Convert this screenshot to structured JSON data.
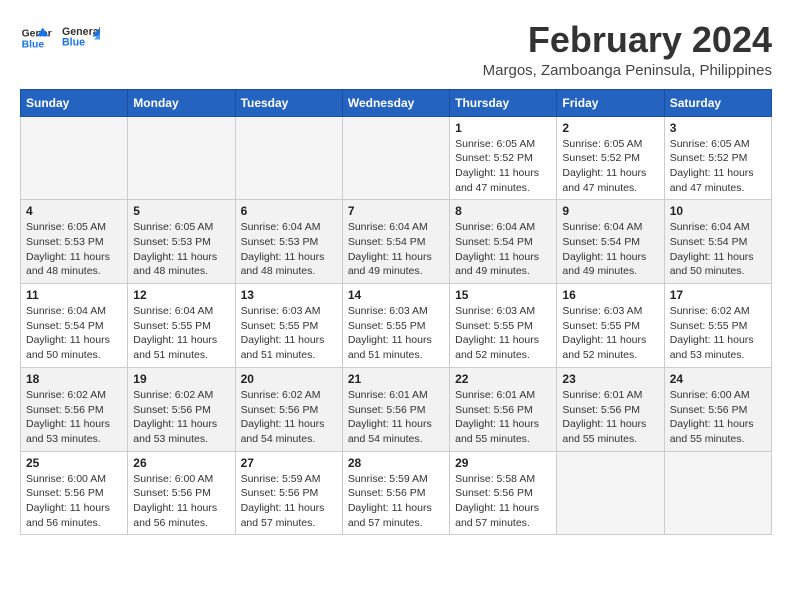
{
  "header": {
    "logo_general": "General",
    "logo_blue": "Blue",
    "month_year": "February 2024",
    "location": "Margos, Zamboanga Peninsula, Philippines"
  },
  "weekdays": [
    "Sunday",
    "Monday",
    "Tuesday",
    "Wednesday",
    "Thursday",
    "Friday",
    "Saturday"
  ],
  "weeks": [
    [
      {
        "day": "",
        "info": ""
      },
      {
        "day": "",
        "info": ""
      },
      {
        "day": "",
        "info": ""
      },
      {
        "day": "",
        "info": ""
      },
      {
        "day": "1",
        "info": "Sunrise: 6:05 AM\nSunset: 5:52 PM\nDaylight: 11 hours\nand 47 minutes."
      },
      {
        "day": "2",
        "info": "Sunrise: 6:05 AM\nSunset: 5:52 PM\nDaylight: 11 hours\nand 47 minutes."
      },
      {
        "day": "3",
        "info": "Sunrise: 6:05 AM\nSunset: 5:52 PM\nDaylight: 11 hours\nand 47 minutes."
      }
    ],
    [
      {
        "day": "4",
        "info": "Sunrise: 6:05 AM\nSunset: 5:53 PM\nDaylight: 11 hours\nand 48 minutes."
      },
      {
        "day": "5",
        "info": "Sunrise: 6:05 AM\nSunset: 5:53 PM\nDaylight: 11 hours\nand 48 minutes."
      },
      {
        "day": "6",
        "info": "Sunrise: 6:04 AM\nSunset: 5:53 PM\nDaylight: 11 hours\nand 48 minutes."
      },
      {
        "day": "7",
        "info": "Sunrise: 6:04 AM\nSunset: 5:54 PM\nDaylight: 11 hours\nand 49 minutes."
      },
      {
        "day": "8",
        "info": "Sunrise: 6:04 AM\nSunset: 5:54 PM\nDaylight: 11 hours\nand 49 minutes."
      },
      {
        "day": "9",
        "info": "Sunrise: 6:04 AM\nSunset: 5:54 PM\nDaylight: 11 hours\nand 49 minutes."
      },
      {
        "day": "10",
        "info": "Sunrise: 6:04 AM\nSunset: 5:54 PM\nDaylight: 11 hours\nand 50 minutes."
      }
    ],
    [
      {
        "day": "11",
        "info": "Sunrise: 6:04 AM\nSunset: 5:54 PM\nDaylight: 11 hours\nand 50 minutes."
      },
      {
        "day": "12",
        "info": "Sunrise: 6:04 AM\nSunset: 5:55 PM\nDaylight: 11 hours\nand 51 minutes."
      },
      {
        "day": "13",
        "info": "Sunrise: 6:03 AM\nSunset: 5:55 PM\nDaylight: 11 hours\nand 51 minutes."
      },
      {
        "day": "14",
        "info": "Sunrise: 6:03 AM\nSunset: 5:55 PM\nDaylight: 11 hours\nand 51 minutes."
      },
      {
        "day": "15",
        "info": "Sunrise: 6:03 AM\nSunset: 5:55 PM\nDaylight: 11 hours\nand 52 minutes."
      },
      {
        "day": "16",
        "info": "Sunrise: 6:03 AM\nSunset: 5:55 PM\nDaylight: 11 hours\nand 52 minutes."
      },
      {
        "day": "17",
        "info": "Sunrise: 6:02 AM\nSunset: 5:55 PM\nDaylight: 11 hours\nand 53 minutes."
      }
    ],
    [
      {
        "day": "18",
        "info": "Sunrise: 6:02 AM\nSunset: 5:56 PM\nDaylight: 11 hours\nand 53 minutes."
      },
      {
        "day": "19",
        "info": "Sunrise: 6:02 AM\nSunset: 5:56 PM\nDaylight: 11 hours\nand 53 minutes."
      },
      {
        "day": "20",
        "info": "Sunrise: 6:02 AM\nSunset: 5:56 PM\nDaylight: 11 hours\nand 54 minutes."
      },
      {
        "day": "21",
        "info": "Sunrise: 6:01 AM\nSunset: 5:56 PM\nDaylight: 11 hours\nand 54 minutes."
      },
      {
        "day": "22",
        "info": "Sunrise: 6:01 AM\nSunset: 5:56 PM\nDaylight: 11 hours\nand 55 minutes."
      },
      {
        "day": "23",
        "info": "Sunrise: 6:01 AM\nSunset: 5:56 PM\nDaylight: 11 hours\nand 55 minutes."
      },
      {
        "day": "24",
        "info": "Sunrise: 6:00 AM\nSunset: 5:56 PM\nDaylight: 11 hours\nand 55 minutes."
      }
    ],
    [
      {
        "day": "25",
        "info": "Sunrise: 6:00 AM\nSunset: 5:56 PM\nDaylight: 11 hours\nand 56 minutes."
      },
      {
        "day": "26",
        "info": "Sunrise: 6:00 AM\nSunset: 5:56 PM\nDaylight: 11 hours\nand 56 minutes."
      },
      {
        "day": "27",
        "info": "Sunrise: 5:59 AM\nSunset: 5:56 PM\nDaylight: 11 hours\nand 57 minutes."
      },
      {
        "day": "28",
        "info": "Sunrise: 5:59 AM\nSunset: 5:56 PM\nDaylight: 11 hours\nand 57 minutes."
      },
      {
        "day": "29",
        "info": "Sunrise: 5:58 AM\nSunset: 5:56 PM\nDaylight: 11 hours\nand 57 minutes."
      },
      {
        "day": "",
        "info": ""
      },
      {
        "day": "",
        "info": ""
      }
    ]
  ]
}
